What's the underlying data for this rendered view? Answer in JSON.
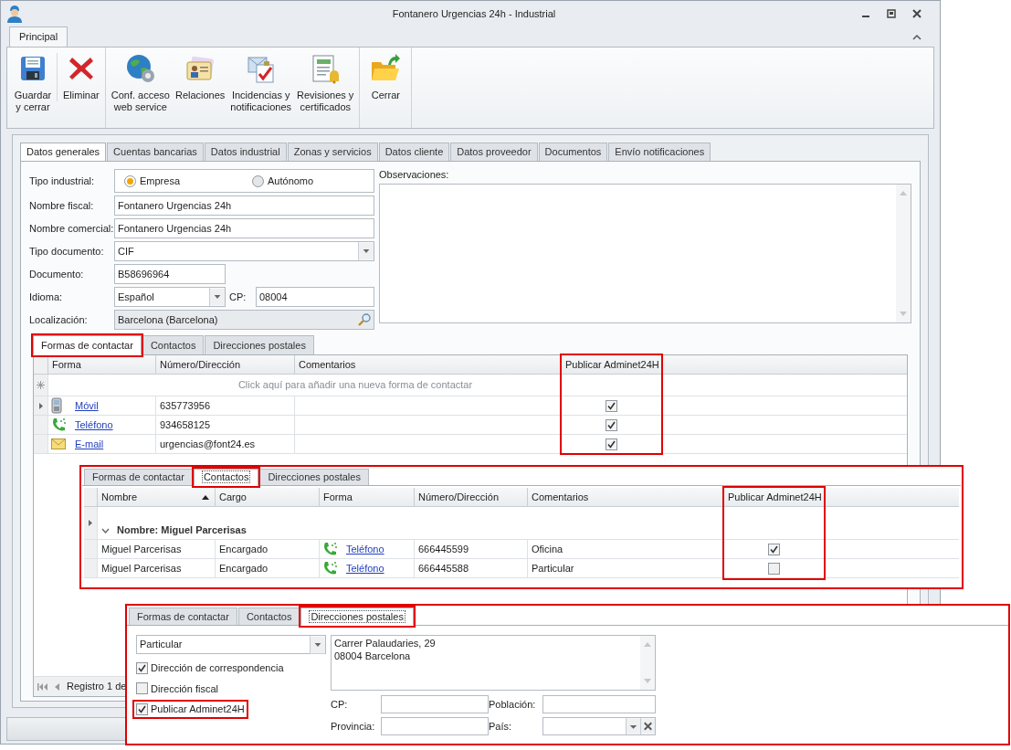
{
  "window": {
    "title": "Fontanero Urgencias 24h - Industrial"
  },
  "ribbon": {
    "tabs": [
      {
        "label": "Principal",
        "selected": true
      }
    ],
    "groups": [
      {
        "buttons": [
          {
            "label": "Guardar\ny cerrar",
            "kind": "save"
          },
          {
            "label": "Eliminar",
            "kind": "delete"
          }
        ]
      },
      {
        "buttons": [
          {
            "label": "Conf. acceso\nweb service",
            "kind": "webservice"
          },
          {
            "label": "Relaciones",
            "kind": "relations"
          },
          {
            "label": "Incidencias y\nnotificaciones",
            "kind": "incidents"
          },
          {
            "label": "Revisiones y\ncertificados",
            "kind": "reviews"
          }
        ]
      },
      {
        "buttons": [
          {
            "label": "Cerrar",
            "kind": "close"
          }
        ]
      }
    ]
  },
  "tabs": [
    {
      "label": "Datos generales",
      "selected": true
    },
    {
      "label": "Cuentas bancarias",
      "selected": false
    },
    {
      "label": "Datos industrial",
      "selected": false
    },
    {
      "label": "Zonas y servicios",
      "selected": false
    },
    {
      "label": "Datos cliente",
      "selected": false
    },
    {
      "label": "Datos proveedor",
      "selected": false
    },
    {
      "label": "Documentos",
      "selected": false
    },
    {
      "label": "Envío notificaciones",
      "selected": false
    }
  ],
  "form": {
    "tipo_industrial": {
      "label": "Tipo industrial:",
      "options": [
        {
          "label": "Empresa",
          "selected": true
        },
        {
          "label": "Autónomo",
          "selected": false
        }
      ]
    },
    "fields": [
      {
        "label": "Nombre fiscal:",
        "kind": "text",
        "value": "Fontanero Urgencias 24h"
      },
      {
        "label": "Nombre comercial:",
        "kind": "text",
        "value": "Fontanero Urgencias 24h"
      },
      {
        "label": "Tipo documento:",
        "kind": "select",
        "value": "CIF"
      },
      {
        "label": "Documento:",
        "kind": "short",
        "value": "B58696964"
      },
      {
        "label": "Idioma:",
        "kind": "select_cp",
        "value": "Español",
        "cp_label": "CP:",
        "cp_value": "08004"
      },
      {
        "label": "Localización:",
        "kind": "lookup",
        "value": "Barcelona (Barcelona)"
      }
    ],
    "observaciones": {
      "label": "Observaciones:"
    }
  },
  "contact_forms": {
    "tabs": [
      {
        "label": "Formas de contactar",
        "selected": true,
        "highlighted": true
      },
      {
        "label": "Contactos",
        "selected": false,
        "highlighted": false
      },
      {
        "label": "Direcciones postales",
        "selected": false,
        "highlighted": false
      }
    ],
    "columns": [
      {
        "label": "Forma",
        "highlighted": false
      },
      {
        "label": "Número/Dirección",
        "highlighted": false
      },
      {
        "label": "Comentarios",
        "highlighted": false
      },
      {
        "label": "Publicar Adminet24H",
        "highlighted": true
      }
    ],
    "new_row_hint": "Click aquí para añadir una nueva forma de contactar",
    "rows": [
      {
        "kind": "mobile",
        "forma": "Móvil",
        "numero": "635773956",
        "publicar": true,
        "current": true
      },
      {
        "kind": "phone",
        "forma": "Teléfono",
        "numero": "934658125",
        "publicar": true,
        "current": false
      },
      {
        "kind": "email",
        "forma": "E-mail",
        "numero": "urgencias@font24.es",
        "publicar": true,
        "current": false
      }
    ],
    "pager": "Registro 1 de"
  },
  "contacts_callout": {
    "tabs": [
      {
        "label": "Formas de contactar",
        "selected": false,
        "highlighted": false
      },
      {
        "label": "Contactos",
        "selected": true,
        "highlighted": true
      },
      {
        "label": "Direcciones postales",
        "selected": false,
        "highlighted": false
      }
    ],
    "columns": [
      {
        "label": "Nombre",
        "sorted": true,
        "highlighted": false
      },
      {
        "label": "Cargo",
        "sorted": false,
        "highlighted": false
      },
      {
        "label": "Forma",
        "sorted": false,
        "highlighted": false
      },
      {
        "label": "Número/Dirección",
        "sorted": false,
        "highlighted": false
      },
      {
        "label": "Comentarios",
        "sorted": false,
        "highlighted": false
      },
      {
        "label": "Publicar Adminet24H",
        "sorted": false,
        "highlighted": true
      }
    ],
    "group": {
      "label": "Nombre: Miguel Parcerisas",
      "expanded": true
    },
    "rows": [
      {
        "nombre": "Miguel Parcerisas",
        "cargo": "Encargado",
        "kind": "phone",
        "forma": "Teléfono",
        "numero": "666445599",
        "comentarios": "Oficina",
        "publicar": true
      },
      {
        "nombre": "Miguel Parcerisas",
        "cargo": "Encargado",
        "kind": "phone",
        "forma": "Teléfono",
        "numero": "666445588",
        "comentarios": "Particular",
        "publicar": false
      }
    ]
  },
  "addresses_callout": {
    "tabs": [
      {
        "label": "Formas de contactar",
        "selected": false,
        "highlighted": false
      },
      {
        "label": "Contactos",
        "selected": false,
        "highlighted": false
      },
      {
        "label": "Direcciones postales",
        "selected": true,
        "highlighted": true
      }
    ],
    "type": "Particular",
    "checkboxes": [
      {
        "label": "Dirección de correspondencia",
        "checked": true,
        "highlighted": false
      },
      {
        "label": "Dirección fiscal",
        "checked": false,
        "highlighted": false
      },
      {
        "label": "Publicar Adminet24H",
        "checked": true,
        "highlighted": true
      }
    ],
    "address": "Carrer Palaudaries, 29\n08004 Barcelona",
    "fields": [
      {
        "label": "CP:",
        "kind": "text"
      },
      {
        "label": "Población:",
        "kind": "text"
      },
      {
        "label": "Provincia:",
        "kind": "text"
      },
      {
        "label": "País:",
        "kind": "select_clear"
      }
    ]
  }
}
